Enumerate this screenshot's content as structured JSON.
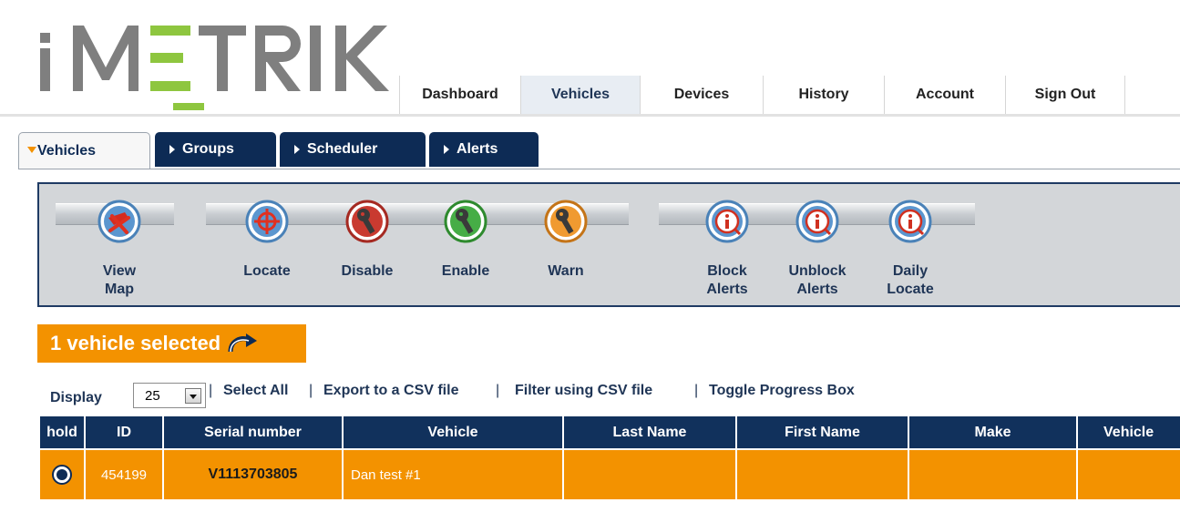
{
  "brand": {
    "logo_text": "iMETRIK",
    "logo_color": "#7f7f7f",
    "accent_green": "#8ec63f"
  },
  "topnav": {
    "active": "Vehicles",
    "tabs": [
      "Dashboard",
      "Vehicles",
      "Devices",
      "History",
      "Account",
      "Sign Out"
    ]
  },
  "subtabs": {
    "active": "Vehicles",
    "items": [
      "Vehicles",
      "Groups",
      "Scheduler",
      "Alerts"
    ]
  },
  "toolbar": {
    "tools": [
      {
        "label1": "View",
        "label2": "Map",
        "icon": "view-map-icon",
        "color": "#3a7fc0"
      },
      {
        "label1": "Locate",
        "label2": "",
        "icon": "crosshair-icon",
        "color": "#3a7fc0"
      },
      {
        "label1": "Disable",
        "label2": "",
        "icon": "key-red-icon",
        "color": "#c0352b"
      },
      {
        "label1": "Enable",
        "label2": "",
        "icon": "key-green-icon",
        "color": "#3aa13a"
      },
      {
        "label1": "Warn",
        "label2": "",
        "icon": "key-orange-icon",
        "color": "#f09020"
      },
      {
        "label1": "Block",
        "label2": "Alerts",
        "icon": "info-alert-icon",
        "color": "#3a7fc0"
      },
      {
        "label1": "Unblock",
        "label2": "Alerts",
        "icon": "info-alert-icon",
        "color": "#3a7fc0"
      },
      {
        "label1": "Daily",
        "label2": "Locate",
        "icon": "info-alert-icon",
        "color": "#3a7fc0"
      }
    ]
  },
  "selection": {
    "text": "1 vehicle selected",
    "icon": "curved-arrow-icon"
  },
  "list_controls": {
    "display_label": "Display",
    "page_size": "25",
    "select_all": "Select All",
    "export_csv": "Export to a CSV file",
    "filter_csv": "Filter using CSV file",
    "toggle_progress": "Toggle Progress Box",
    "separator": "|"
  },
  "table": {
    "columns": [
      "hold",
      "ID",
      "Serial number",
      "Vehicle",
      "Last Name",
      "First Name",
      "Make",
      "Vehicle"
    ],
    "rows": [
      {
        "hold": "selected",
        "id": "454199",
        "serial": "V1113703805",
        "vehicle": "Dan test #1",
        "last_name": "",
        "first_name": "",
        "make": "",
        "vehicle2": ""
      }
    ]
  },
  "colors": {
    "navy": "#11315c",
    "orange": "#f39200",
    "toolbar_bg": "#d3d6d9"
  }
}
